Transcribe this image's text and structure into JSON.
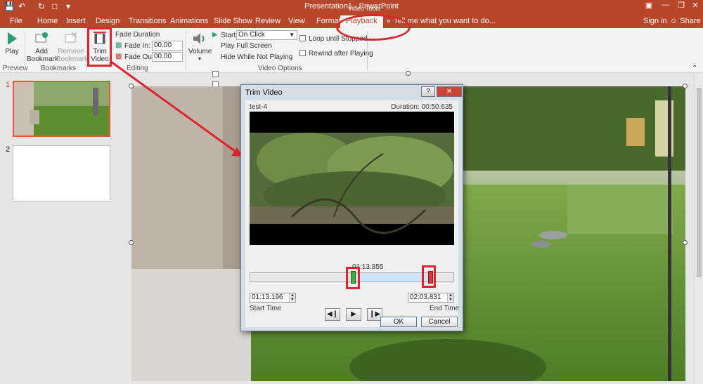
{
  "titlebar": {
    "title": "Presentation1 - PowerPoint"
  },
  "tabs": {
    "file": "File",
    "home": "Home",
    "insert": "Insert",
    "design": "Design",
    "transitions": "Transitions",
    "animations": "Animations",
    "slideshow": "Slide Show",
    "review": "Review",
    "view": "View",
    "format": "Format",
    "playback": "Playback",
    "context_group": "Video Tools",
    "tell_me": "Tell me what you want to do...",
    "signin": "Sign in",
    "share": "Share"
  },
  "ribbon": {
    "play": "Play",
    "add_bookmark_1": "Add",
    "add_bookmark_2": "Bookmark",
    "remove_bookmark_1": "Remove",
    "remove_bookmark_2": "Bookmark",
    "trim_1": "Trim",
    "trim_2": "Video",
    "fade_duration": "Fade Duration",
    "fade_in_label": "Fade In:",
    "fade_in_value": "00.00",
    "fade_out_label": "Fade Out:",
    "fade_out_value": "00.00",
    "volume": "Volume",
    "start_label": "Start:",
    "start_value": "On Click",
    "play_full_screen": "Play Full Screen",
    "hide_while": "Hide While Not Playing",
    "loop": "Loop until Stopped",
    "rewind": "Rewind after Playing",
    "group_preview": "Preview",
    "group_bookmarks": "Bookmarks",
    "group_editing": "Editing",
    "group_video_options": "Video Options"
  },
  "thumbs": {
    "n1": "1",
    "n2": "2"
  },
  "dialog": {
    "title": "Trim Video",
    "help": "?",
    "file_name": "test-4",
    "duration": "Duration: 00:50.635",
    "current_time": "01:13.855",
    "start_time_value": "01:13.196",
    "start_time_label": "Start Time",
    "end_time_value": "02:03.831",
    "end_time_label": "End Time",
    "ok": "OK",
    "cancel": "Cancel"
  },
  "colors": {
    "accent": "#b7472a",
    "highlight": "#e0232e"
  },
  "icons": {
    "save": "save-icon",
    "undo": "undo-icon",
    "redo": "redo-icon",
    "play": "play-icon",
    "prev_frame": "previous-frame-icon",
    "next_frame": "next-frame-icon",
    "volume": "speaker-icon"
  }
}
